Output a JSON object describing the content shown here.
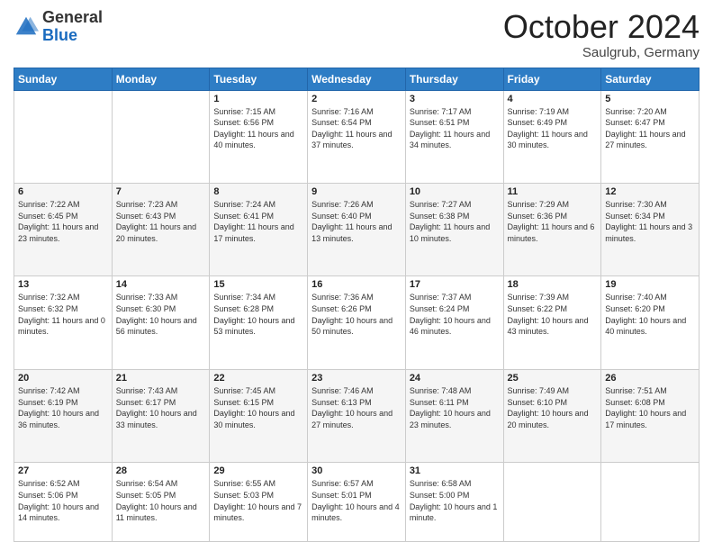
{
  "header": {
    "logo": {
      "general": "General",
      "blue": "Blue"
    },
    "month": "October 2024",
    "location": "Saulgrub, Germany"
  },
  "weekdays": [
    "Sunday",
    "Monday",
    "Tuesday",
    "Wednesday",
    "Thursday",
    "Friday",
    "Saturday"
  ],
  "weeks": [
    [
      {
        "day": "",
        "sunrise": "",
        "sunset": "",
        "daylight": ""
      },
      {
        "day": "",
        "sunrise": "",
        "sunset": "",
        "daylight": ""
      },
      {
        "day": "1",
        "sunrise": "Sunrise: 7:15 AM",
        "sunset": "Sunset: 6:56 PM",
        "daylight": "Daylight: 11 hours and 40 minutes."
      },
      {
        "day": "2",
        "sunrise": "Sunrise: 7:16 AM",
        "sunset": "Sunset: 6:54 PM",
        "daylight": "Daylight: 11 hours and 37 minutes."
      },
      {
        "day": "3",
        "sunrise": "Sunrise: 7:17 AM",
        "sunset": "Sunset: 6:51 PM",
        "daylight": "Daylight: 11 hours and 34 minutes."
      },
      {
        "day": "4",
        "sunrise": "Sunrise: 7:19 AM",
        "sunset": "Sunset: 6:49 PM",
        "daylight": "Daylight: 11 hours and 30 minutes."
      },
      {
        "day": "5",
        "sunrise": "Sunrise: 7:20 AM",
        "sunset": "Sunset: 6:47 PM",
        "daylight": "Daylight: 11 hours and 27 minutes."
      }
    ],
    [
      {
        "day": "6",
        "sunrise": "Sunrise: 7:22 AM",
        "sunset": "Sunset: 6:45 PM",
        "daylight": "Daylight: 11 hours and 23 minutes."
      },
      {
        "day": "7",
        "sunrise": "Sunrise: 7:23 AM",
        "sunset": "Sunset: 6:43 PM",
        "daylight": "Daylight: 11 hours and 20 minutes."
      },
      {
        "day": "8",
        "sunrise": "Sunrise: 7:24 AM",
        "sunset": "Sunset: 6:41 PM",
        "daylight": "Daylight: 11 hours and 17 minutes."
      },
      {
        "day": "9",
        "sunrise": "Sunrise: 7:26 AM",
        "sunset": "Sunset: 6:40 PM",
        "daylight": "Daylight: 11 hours and 13 minutes."
      },
      {
        "day": "10",
        "sunrise": "Sunrise: 7:27 AM",
        "sunset": "Sunset: 6:38 PM",
        "daylight": "Daylight: 11 hours and 10 minutes."
      },
      {
        "day": "11",
        "sunrise": "Sunrise: 7:29 AM",
        "sunset": "Sunset: 6:36 PM",
        "daylight": "Daylight: 11 hours and 6 minutes."
      },
      {
        "day": "12",
        "sunrise": "Sunrise: 7:30 AM",
        "sunset": "Sunset: 6:34 PM",
        "daylight": "Daylight: 11 hours and 3 minutes."
      }
    ],
    [
      {
        "day": "13",
        "sunrise": "Sunrise: 7:32 AM",
        "sunset": "Sunset: 6:32 PM",
        "daylight": "Daylight: 11 hours and 0 minutes."
      },
      {
        "day": "14",
        "sunrise": "Sunrise: 7:33 AM",
        "sunset": "Sunset: 6:30 PM",
        "daylight": "Daylight: 10 hours and 56 minutes."
      },
      {
        "day": "15",
        "sunrise": "Sunrise: 7:34 AM",
        "sunset": "Sunset: 6:28 PM",
        "daylight": "Daylight: 10 hours and 53 minutes."
      },
      {
        "day": "16",
        "sunrise": "Sunrise: 7:36 AM",
        "sunset": "Sunset: 6:26 PM",
        "daylight": "Daylight: 10 hours and 50 minutes."
      },
      {
        "day": "17",
        "sunrise": "Sunrise: 7:37 AM",
        "sunset": "Sunset: 6:24 PM",
        "daylight": "Daylight: 10 hours and 46 minutes."
      },
      {
        "day": "18",
        "sunrise": "Sunrise: 7:39 AM",
        "sunset": "Sunset: 6:22 PM",
        "daylight": "Daylight: 10 hours and 43 minutes."
      },
      {
        "day": "19",
        "sunrise": "Sunrise: 7:40 AM",
        "sunset": "Sunset: 6:20 PM",
        "daylight": "Daylight: 10 hours and 40 minutes."
      }
    ],
    [
      {
        "day": "20",
        "sunrise": "Sunrise: 7:42 AM",
        "sunset": "Sunset: 6:19 PM",
        "daylight": "Daylight: 10 hours and 36 minutes."
      },
      {
        "day": "21",
        "sunrise": "Sunrise: 7:43 AM",
        "sunset": "Sunset: 6:17 PM",
        "daylight": "Daylight: 10 hours and 33 minutes."
      },
      {
        "day": "22",
        "sunrise": "Sunrise: 7:45 AM",
        "sunset": "Sunset: 6:15 PM",
        "daylight": "Daylight: 10 hours and 30 minutes."
      },
      {
        "day": "23",
        "sunrise": "Sunrise: 7:46 AM",
        "sunset": "Sunset: 6:13 PM",
        "daylight": "Daylight: 10 hours and 27 minutes."
      },
      {
        "day": "24",
        "sunrise": "Sunrise: 7:48 AM",
        "sunset": "Sunset: 6:11 PM",
        "daylight": "Daylight: 10 hours and 23 minutes."
      },
      {
        "day": "25",
        "sunrise": "Sunrise: 7:49 AM",
        "sunset": "Sunset: 6:10 PM",
        "daylight": "Daylight: 10 hours and 20 minutes."
      },
      {
        "day": "26",
        "sunrise": "Sunrise: 7:51 AM",
        "sunset": "Sunset: 6:08 PM",
        "daylight": "Daylight: 10 hours and 17 minutes."
      }
    ],
    [
      {
        "day": "27",
        "sunrise": "Sunrise: 6:52 AM",
        "sunset": "Sunset: 5:06 PM",
        "daylight": "Daylight: 10 hours and 14 minutes."
      },
      {
        "day": "28",
        "sunrise": "Sunrise: 6:54 AM",
        "sunset": "Sunset: 5:05 PM",
        "daylight": "Daylight: 10 hours and 11 minutes."
      },
      {
        "day": "29",
        "sunrise": "Sunrise: 6:55 AM",
        "sunset": "Sunset: 5:03 PM",
        "daylight": "Daylight: 10 hours and 7 minutes."
      },
      {
        "day": "30",
        "sunrise": "Sunrise: 6:57 AM",
        "sunset": "Sunset: 5:01 PM",
        "daylight": "Daylight: 10 hours and 4 minutes."
      },
      {
        "day": "31",
        "sunrise": "Sunrise: 6:58 AM",
        "sunset": "Sunset: 5:00 PM",
        "daylight": "Daylight: 10 hours and 1 minute."
      },
      {
        "day": "",
        "sunrise": "",
        "sunset": "",
        "daylight": ""
      },
      {
        "day": "",
        "sunrise": "",
        "sunset": "",
        "daylight": ""
      }
    ]
  ]
}
